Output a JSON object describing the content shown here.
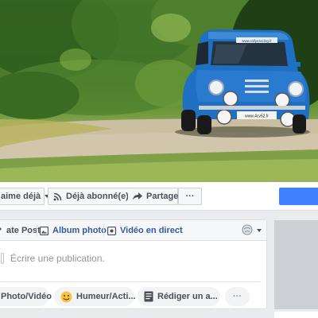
{
  "cover": {
    "plates": [
      "www.rallyeracing.fr",
      "www.4cv52.fr"
    ]
  },
  "actions": {
    "like_label": "aime déjà",
    "follow_label": "Déjà abonné(e)",
    "share_label": "Partager",
    "more_label": "···"
  },
  "composer": {
    "tabs": {
      "create": "ate Post",
      "album": "Album photo",
      "live": "Vidéo en direct"
    },
    "placeholder": "Écrire une publication.",
    "buttons": {
      "photo": "Photo/Vidéo",
      "mood": "Humeur/Acti...",
      "write": "Rédiger un a...",
      "more": "···"
    }
  },
  "colors": {
    "link": "#365899",
    "accent": "#4080ff",
    "car_blue": "#1f6fc2"
  },
  "icons": [
    "thumbs-up-icon",
    "rss-icon",
    "share-arrow-icon",
    "pencil-icon",
    "photo-album-icon",
    "video-camera-icon",
    "globe-icon",
    "photo-icon",
    "emoji-icon",
    "document-icon"
  ]
}
